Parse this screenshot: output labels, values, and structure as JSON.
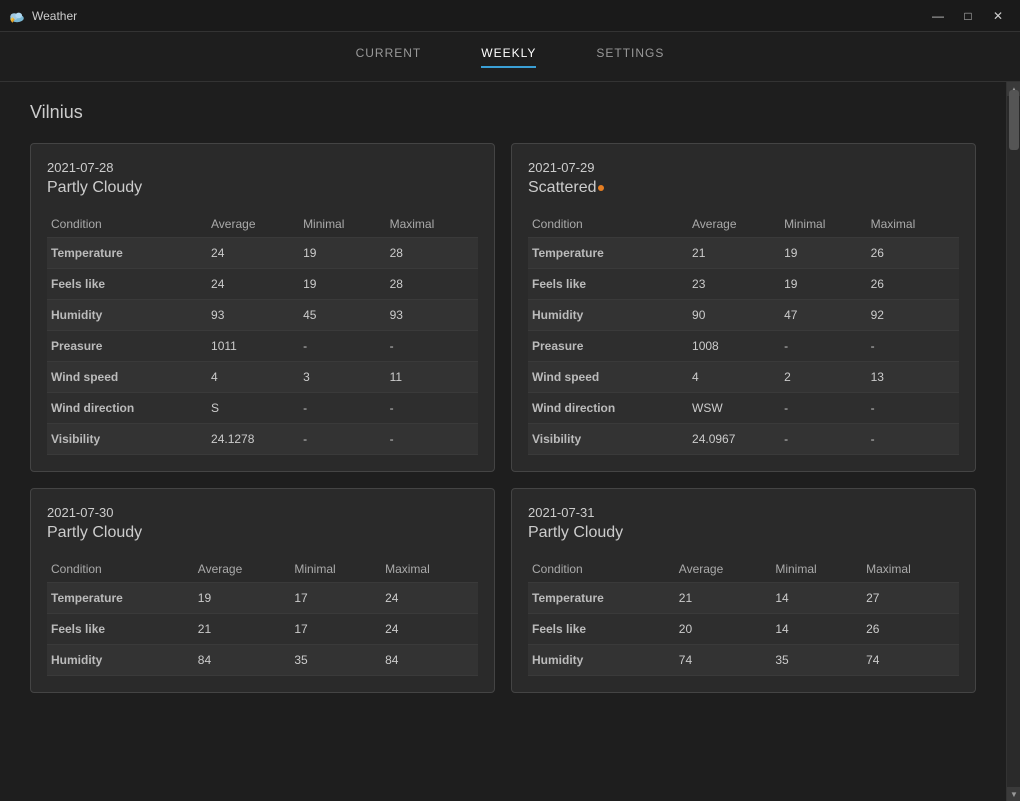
{
  "app": {
    "title": "Weather",
    "titlebar_controls": {
      "minimize": "—",
      "maximize": "□",
      "close": "✕"
    }
  },
  "nav": {
    "tabs": [
      {
        "id": "current",
        "label": "CURRENT",
        "active": false
      },
      {
        "id": "weekly",
        "label": "WEEKLY",
        "active": true
      },
      {
        "id": "settings",
        "label": "SETTINGS",
        "active": false
      }
    ]
  },
  "city": "Vilnius",
  "cards": [
    {
      "date": "2021-07-28",
      "condition": "Partly Cloudy",
      "has_dot": false,
      "columns": [
        "Condition",
        "Average",
        "Minimal",
        "Maximal"
      ],
      "rows": [
        {
          "condition": "Temperature",
          "average": "24",
          "minimal": "19",
          "maximal": "28",
          "min_highlight": true,
          "max_highlight": true
        },
        {
          "condition": "Feels like",
          "average": "24",
          "minimal": "19",
          "maximal": "28",
          "min_highlight": true,
          "max_highlight": true
        },
        {
          "condition": "Humidity",
          "average": "93",
          "minimal": "45",
          "maximal": "93",
          "min_highlight": false,
          "max_highlight": false
        },
        {
          "condition": "Preasure",
          "average": "1011",
          "minimal": "-",
          "maximal": "-",
          "min_highlight": false,
          "max_highlight": false
        },
        {
          "condition": "Wind speed",
          "average": "4",
          "minimal": "3",
          "maximal": "11",
          "min_highlight": false,
          "max_highlight": false
        },
        {
          "condition": "Wind direction",
          "average": "S",
          "minimal": "-",
          "maximal": "-",
          "min_highlight": false,
          "max_highlight": false
        },
        {
          "condition": "Visibility",
          "average": "24.1278",
          "minimal": "-",
          "maximal": "-",
          "min_highlight": false,
          "max_highlight": false
        }
      ]
    },
    {
      "date": "2021-07-29",
      "condition": "Scattered",
      "has_dot": true,
      "columns": [
        "Condition",
        "Average",
        "Minimal",
        "Maximal"
      ],
      "rows": [
        {
          "condition": "Temperature",
          "average": "21",
          "minimal": "19",
          "maximal": "26",
          "min_highlight": false,
          "max_highlight": false
        },
        {
          "condition": "Feels like",
          "average": "23",
          "minimal": "19",
          "maximal": "26",
          "min_highlight": false,
          "max_highlight": false
        },
        {
          "condition": "Humidity",
          "average": "90",
          "minimal": "47",
          "maximal": "92",
          "min_highlight": false,
          "max_highlight": false
        },
        {
          "condition": "Preasure",
          "average": "1008",
          "minimal": "-",
          "maximal": "-",
          "min_highlight": false,
          "max_highlight": false
        },
        {
          "condition": "Wind speed",
          "average": "4",
          "minimal": "2",
          "maximal": "13",
          "min_highlight": false,
          "max_highlight": false
        },
        {
          "condition": "Wind direction",
          "average": "WSW",
          "minimal": "-",
          "maximal": "-",
          "min_highlight": false,
          "max_highlight": false
        },
        {
          "condition": "Visibility",
          "average": "24.0967",
          "minimal": "-",
          "maximal": "-",
          "min_highlight": false,
          "max_highlight": false
        }
      ]
    },
    {
      "date": "2021-07-30",
      "condition": "Partly Cloudy",
      "has_dot": false,
      "columns": [
        "Condition",
        "Average",
        "Minimal",
        "Maximal"
      ],
      "rows": [
        {
          "condition": "Temperature",
          "average": "19",
          "minimal": "17",
          "maximal": "24",
          "min_highlight": false,
          "max_highlight": false
        },
        {
          "condition": "Feels like",
          "average": "21",
          "minimal": "17",
          "maximal": "24",
          "min_highlight": false,
          "max_highlight": false
        },
        {
          "condition": "Humidity",
          "average": "84",
          "minimal": "35",
          "maximal": "84",
          "min_highlight": false,
          "max_highlight": false
        }
      ]
    },
    {
      "date": "2021-07-31",
      "condition": "Partly Cloudy",
      "has_dot": false,
      "columns": [
        "Condition",
        "Average",
        "Minimal",
        "Maximal"
      ],
      "rows": [
        {
          "condition": "Temperature",
          "average": "21",
          "minimal": "14",
          "maximal": "27",
          "min_highlight": false,
          "max_highlight": false
        },
        {
          "condition": "Feels like",
          "average": "20",
          "minimal": "14",
          "maximal": "26",
          "min_highlight": false,
          "max_highlight": false
        },
        {
          "condition": "Humidity",
          "average": "74",
          "minimal": "35",
          "maximal": "74",
          "min_highlight": false,
          "max_highlight": false
        }
      ]
    }
  ]
}
